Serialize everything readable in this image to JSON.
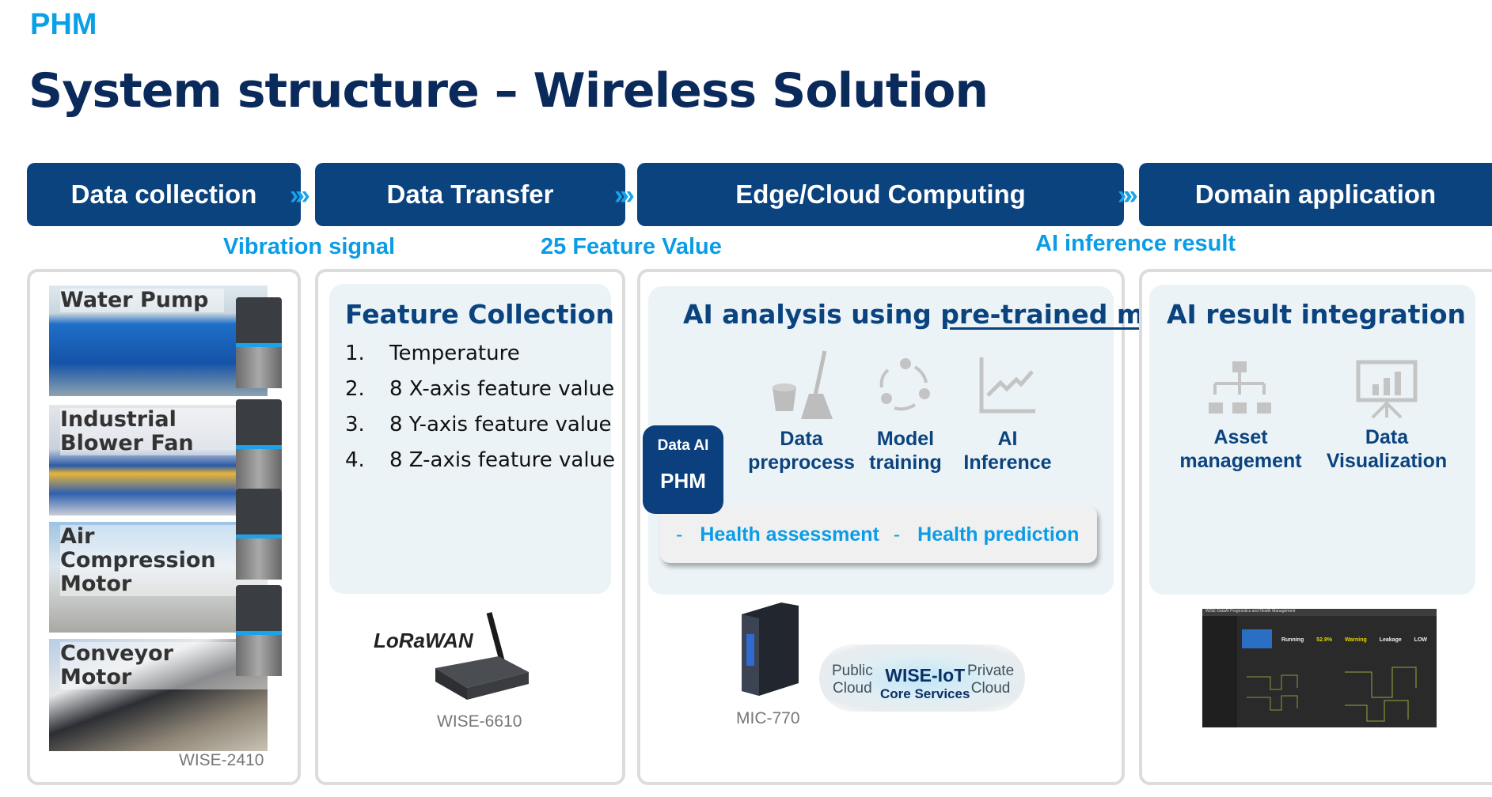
{
  "header": {
    "section": "PHM",
    "title": "System structure – Wireless Solution"
  },
  "stages": [
    "Data collection",
    "Data Transfer",
    "Edge/Cloud Computing",
    "Domain application"
  ],
  "flow_labels": [
    "Vibration signal",
    "25 Feature Value",
    "AI inference result"
  ],
  "data_collection": {
    "machines": [
      "Water Pump",
      "Industrial Blower Fan",
      "Air Compression Motor",
      "Conveyor Motor"
    ],
    "device": "WISE-2410"
  },
  "data_transfer": {
    "title": "Feature Collection",
    "items": [
      {
        "n": "1.",
        "t": "Temperature"
      },
      {
        "n": "2.",
        "t": "8 X-axis feature value"
      },
      {
        "n": "3.",
        "t": "8 Y-axis feature value"
      },
      {
        "n": "4.",
        "t": "8 Z-axis feature value"
      }
    ],
    "logo": "LoRaWAN",
    "device": "WISE-6610"
  },
  "computing": {
    "title_a": "AI analysis using ",
    "title_b": "pre-trained model",
    "badge_top": "Data AI",
    "badge_bottom": "PHM",
    "steps": [
      {
        "l1": "Data",
        "l2": "preprocess",
        "icon": "bucket-broom-icon"
      },
      {
        "l1": "Model",
        "l2": "training",
        "icon": "cycle-icon"
      },
      {
        "l1": "AI",
        "l2": "Inference",
        "icon": "line-chart-icon"
      }
    ],
    "results": [
      "Health assessment",
      "Health prediction"
    ],
    "device": "MIC-770",
    "cloud": {
      "left_1": "Public",
      "left_2": "Cloud",
      "main_1": "WISE-IoT",
      "main_2": "Core Services",
      "right_1": "Private",
      "right_2": "Cloud"
    }
  },
  "domain": {
    "title": "AI result integration",
    "items": [
      {
        "l1": "Asset",
        "l2": "management",
        "icon": "org-chart-icon"
      },
      {
        "l1": "Data",
        "l2": "Visualization",
        "icon": "presentation-chart-icon"
      }
    ],
    "dashboard": {
      "app": "WISE-DataAI Prognostics and Health Management",
      "status": [
        "Running",
        "52.9%",
        "Warning",
        "Leakage",
        "LOW"
      ]
    }
  },
  "colors": {
    "navy": "#0b437f",
    "accent": "#0aa0e6",
    "panel": "#ebf3f6"
  }
}
